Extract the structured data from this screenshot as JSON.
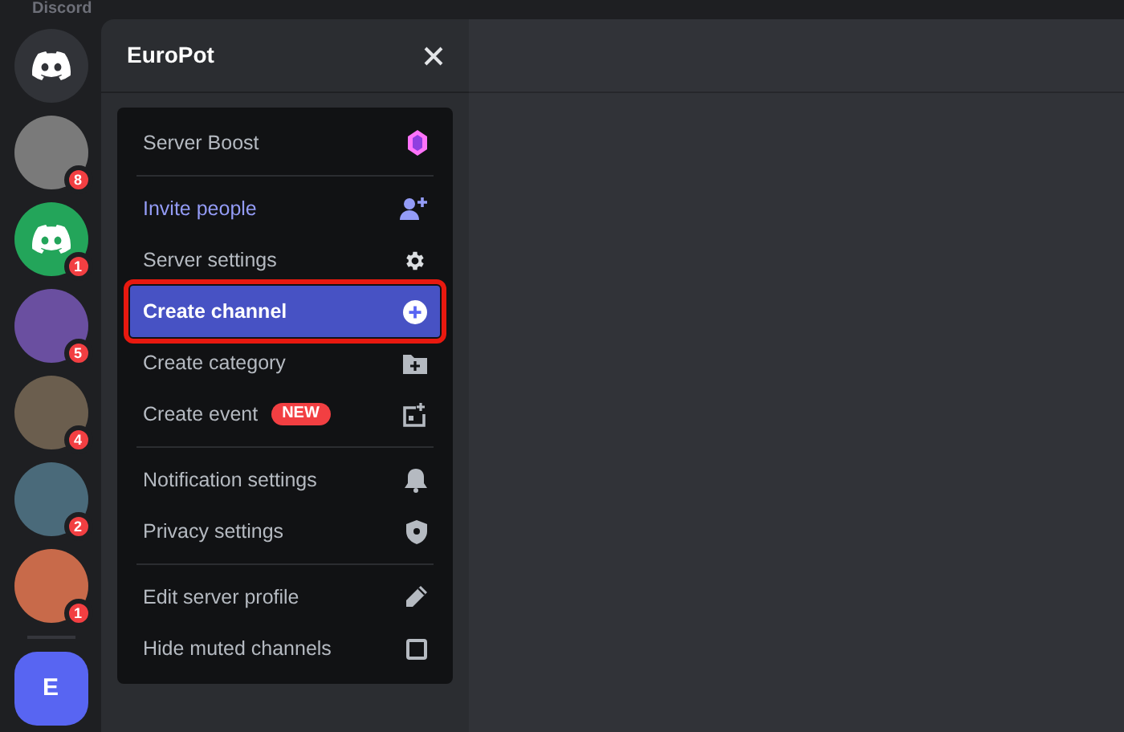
{
  "app_title": "Discord",
  "servers": [
    {
      "kind": "home"
    },
    {
      "kind": "avatar",
      "badge": "8"
    },
    {
      "kind": "discord",
      "badge": "1"
    },
    {
      "kind": "avatar",
      "badge": "5"
    },
    {
      "kind": "avatar",
      "badge": "4"
    },
    {
      "kind": "avatar",
      "badge": "2"
    },
    {
      "kind": "avatar",
      "badge": "1"
    },
    {
      "kind": "letter",
      "label": "E"
    }
  ],
  "server_header": {
    "title": "EuroPot"
  },
  "menu": {
    "groups": [
      [
        {
          "kind": "boost",
          "label": "Server Boost",
          "selected": false
        }
      ],
      [
        {
          "kind": "invite",
          "label": "Invite people",
          "accent": true,
          "selected": false
        },
        {
          "kind": "gear",
          "label": "Server settings",
          "selected": false
        },
        {
          "kind": "plus",
          "label": "Create channel",
          "selected": true
        },
        {
          "kind": "folder",
          "label": "Create category",
          "selected": false
        },
        {
          "kind": "event",
          "label": "Create event",
          "tag": "NEW",
          "selected": false
        }
      ],
      [
        {
          "kind": "bell",
          "label": "Notification settings",
          "selected": false
        },
        {
          "kind": "shield",
          "label": "Privacy settings",
          "selected": false
        }
      ],
      [
        {
          "kind": "pencil",
          "label": "Edit server profile",
          "selected": false
        },
        {
          "kind": "checkbox",
          "label": "Hide muted channels",
          "checked": false,
          "selected": false
        }
      ]
    ]
  }
}
